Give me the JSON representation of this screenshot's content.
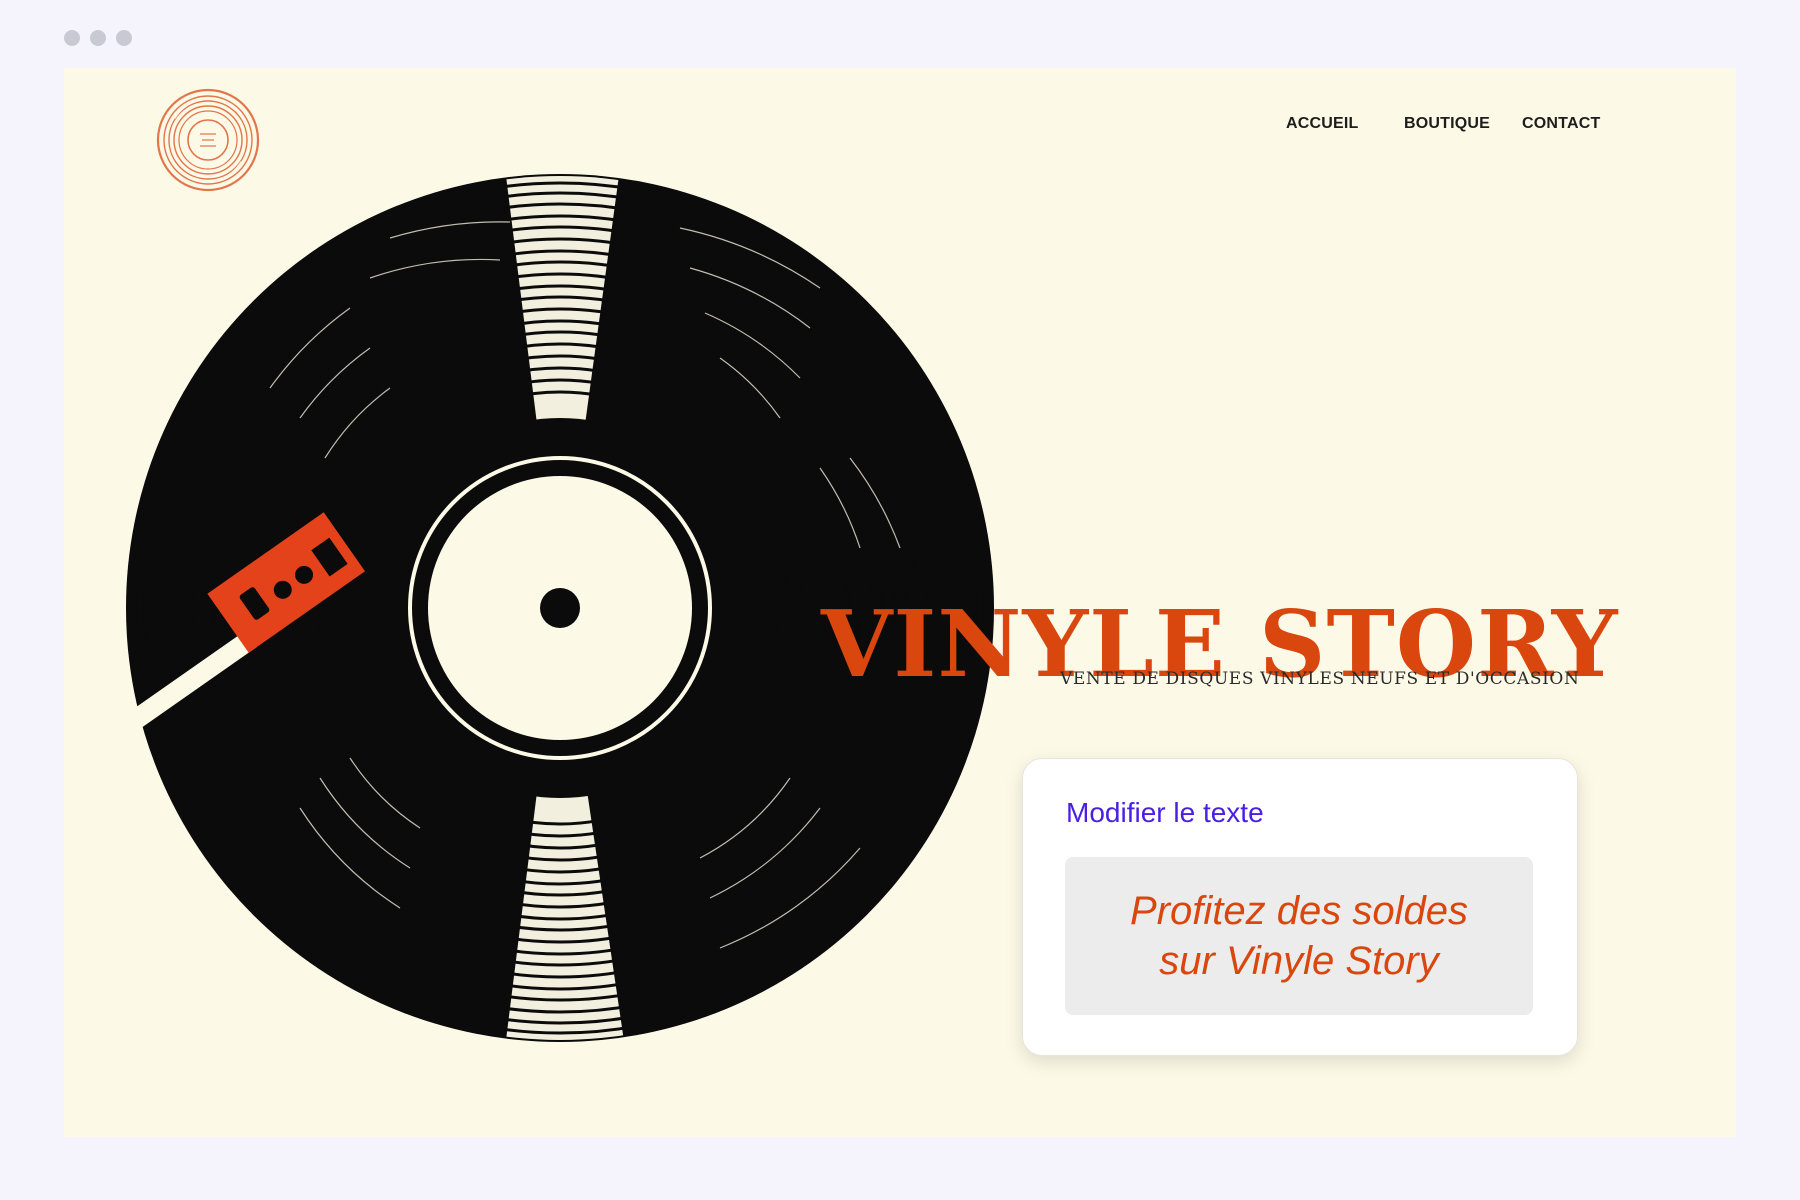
{
  "window": {
    "controls": [
      "dot",
      "dot",
      "dot"
    ]
  },
  "site": {
    "logo_icon": "vinyl-record-logo-icon",
    "nav": {
      "home_label": "ACCUEIL",
      "shop_label": "BOUTIQUE",
      "contact_label": "CONTACT"
    },
    "hero": {
      "image_icon": "vinyl-record-with-tonearm-illustration",
      "title": "VINYLE STORY",
      "tagline": "VENTE DE DISQUES VINYLES NEUFS ET D'OCCASION"
    }
  },
  "text_editor": {
    "title": "Modifier le texte",
    "value": "Profitez des soldes\nsur Vinyle Story"
  },
  "colors": {
    "accent": "#d9460e",
    "editor_title": "#4a1fe3",
    "page_background": "#fdf9e7"
  }
}
